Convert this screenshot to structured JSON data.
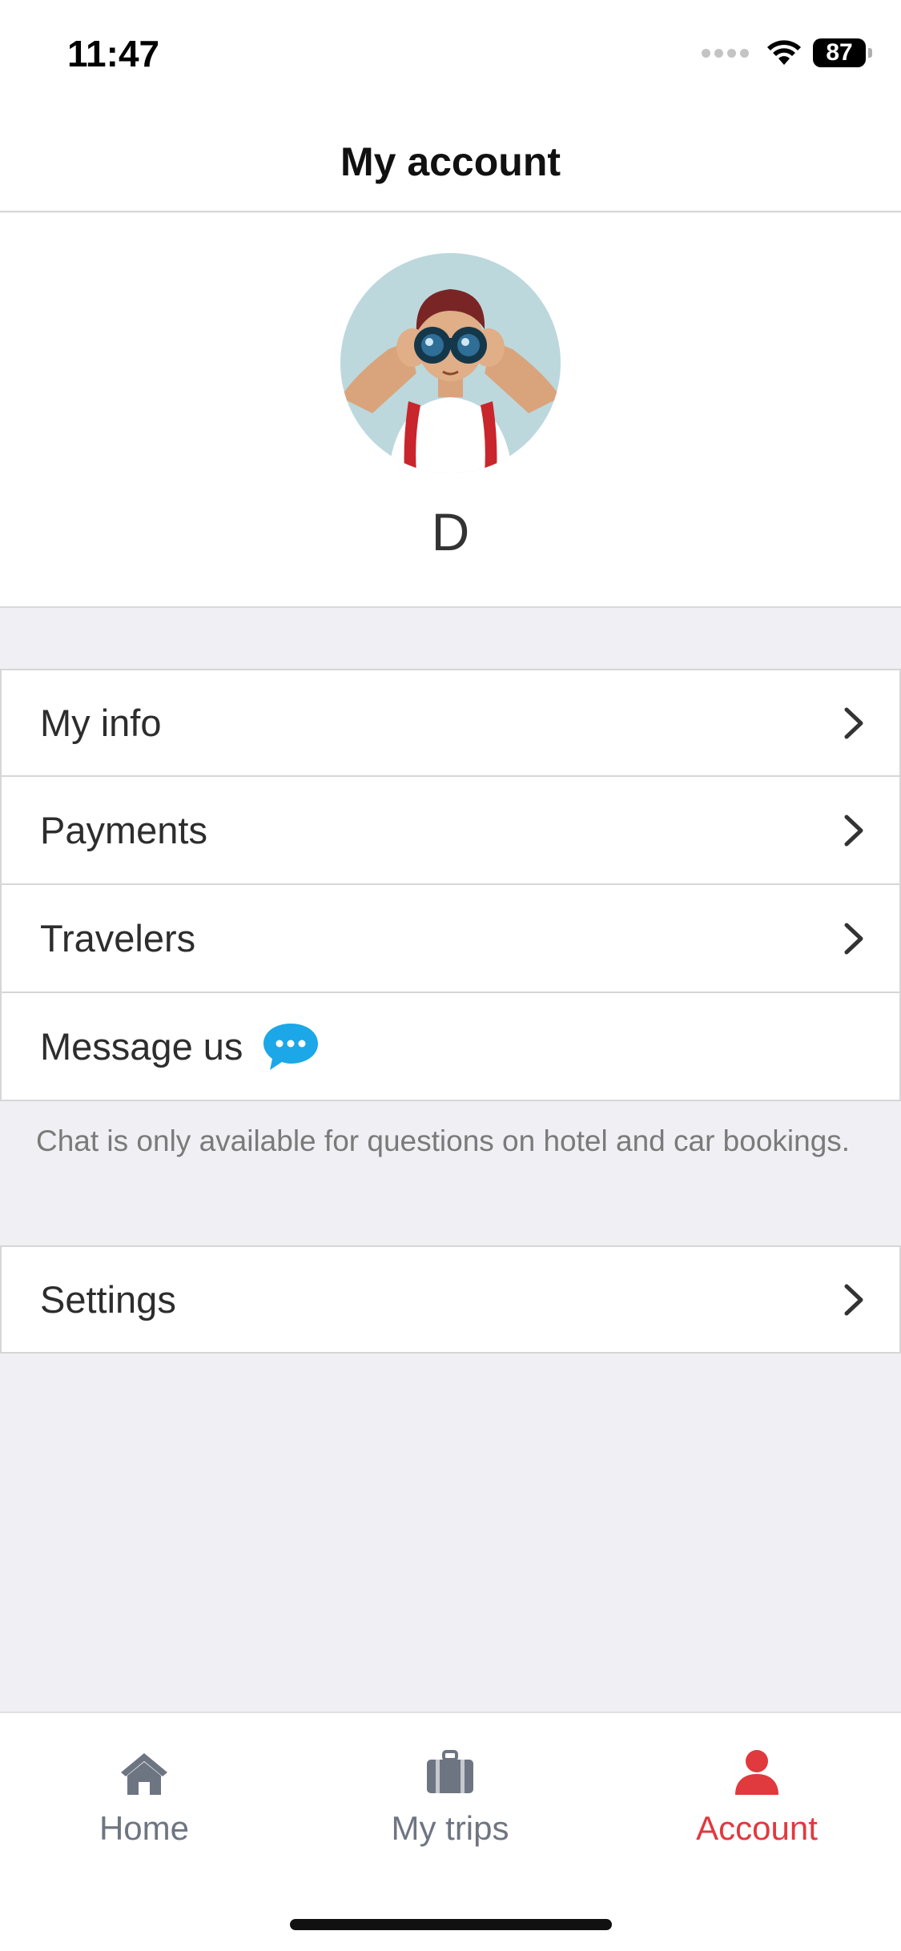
{
  "status_bar": {
    "time": "11:47",
    "battery": "87"
  },
  "header": {
    "title": "My account"
  },
  "profile": {
    "initial": "D"
  },
  "menu": {
    "items": [
      {
        "label": "My info",
        "icon": "chevron-right-icon"
      },
      {
        "label": "Payments",
        "icon": "chevron-right-icon"
      },
      {
        "label": "Travelers",
        "icon": "chevron-right-icon"
      },
      {
        "label": "Message us",
        "icon": "chat-bubble-icon"
      }
    ],
    "chat_note": "Chat is only available for questions on hotel and car bookings.",
    "settings": {
      "label": "Settings",
      "icon": "chevron-right-icon"
    }
  },
  "tab_bar": {
    "tabs": [
      {
        "label": "Home",
        "icon": "home-icon",
        "active": false
      },
      {
        "label": "My trips",
        "icon": "suitcase-icon",
        "active": false
      },
      {
        "label": "Account",
        "icon": "person-icon",
        "active": true
      }
    ]
  },
  "colors": {
    "accent": "#e0393e",
    "chat_blue": "#1ba7e8",
    "tab_inactive": "#6e7582",
    "background": "#efeff4"
  }
}
